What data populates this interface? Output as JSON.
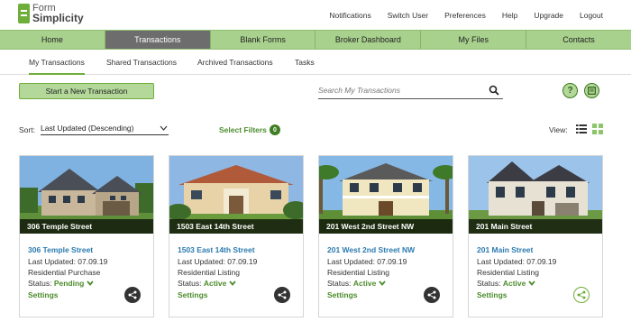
{
  "brand": {
    "line1": "Form",
    "line2": "Simplicity"
  },
  "top_links": [
    "Notifications",
    "Switch User",
    "Preferences",
    "Help",
    "Upgrade",
    "Logout"
  ],
  "main_nav": [
    {
      "label": "Home",
      "active": false
    },
    {
      "label": "Transactions",
      "active": true
    },
    {
      "label": "Blank Forms",
      "active": false
    },
    {
      "label": "Broker Dashboard",
      "active": false
    },
    {
      "label": "My Files",
      "active": false
    },
    {
      "label": "Contacts",
      "active": false
    }
  ],
  "sub_nav": [
    {
      "label": "My Transactions",
      "active": true
    },
    {
      "label": "Shared Transactions",
      "active": false
    },
    {
      "label": "Archived Transactions",
      "active": false
    },
    {
      "label": "Tasks",
      "active": false
    }
  ],
  "actions": {
    "new_transaction_label": "Start a New Transaction",
    "search_placeholder": "Search My Transactions",
    "help_glyph": "?"
  },
  "sort": {
    "label": "Sort:",
    "value": "Last Updated (Descending)"
  },
  "filters": {
    "label": "Select Filters",
    "count": "0"
  },
  "view": {
    "label": "View:"
  },
  "colors": {
    "accent": "#6fae3b",
    "nav": "#a9d18e",
    "active_nav": "#6d6d6d",
    "link": "#2a7ab0"
  },
  "cards": [
    {
      "caption": "306 Temple Street",
      "address": "306 Temple Street",
      "updated": "Last Updated: 07.09.19",
      "type": "Residential Purchase",
      "status_label": "Status:",
      "status": "Pending",
      "settings": "Settings"
    },
    {
      "caption": "1503 East 14th Street",
      "address": "1503 East 14th Street",
      "updated": "Last Updated: 07.09.19",
      "type": "Residential Listing",
      "status_label": "Status:",
      "status": "Active",
      "settings": "Settings"
    },
    {
      "caption": "201 West 2nd Street NW",
      "address": "201 West 2nd Street NW",
      "updated": "Last Updated: 07.09.19",
      "type": "Residential Listing",
      "status_label": "Status:",
      "status": "Active",
      "settings": "Settings"
    },
    {
      "caption": "201 Main Street",
      "address": "201 Main Street",
      "updated": "Last Updated: 07.09.19",
      "type": "Residential Listing",
      "status_label": "Status:",
      "status": "Active",
      "settings": "Settings"
    }
  ]
}
